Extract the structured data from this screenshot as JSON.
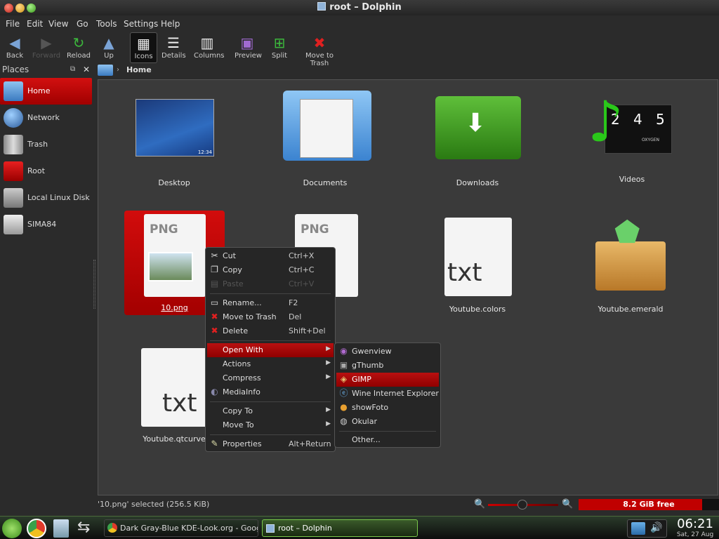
{
  "window": {
    "title": "root – Dolphin"
  },
  "menu": [
    "File",
    "Edit",
    "View",
    "Go",
    "Tools",
    "Settings",
    "Help"
  ],
  "toolbar": [
    "Back",
    "Forward",
    "Reload",
    "Up",
    "Icons",
    "Details",
    "Columns",
    "Preview",
    "Split",
    "Move to Trash"
  ],
  "places": {
    "title": "Places",
    "items": [
      "Home",
      "Network",
      "Trash",
      "Root",
      "Local Linux Disk",
      "SIMA84"
    ]
  },
  "breadcrumb": {
    "current": "Home"
  },
  "files": [
    "Desktop",
    "Documents",
    "Downloads",
    "Videos",
    "10.png",
    "",
    "Youtube.colors",
    "Youtube.emerald",
    "Youtube.qtcurve"
  ],
  "thumb_text": {
    "png": "PNG",
    "txt": "txt",
    "clock_small": "12:34",
    "video": [
      "2",
      "4",
      "5"
    ],
    "video_sub": "OXYGEN"
  },
  "context": [
    {
      "label": "Cut",
      "shortcut": "Ctrl+X",
      "icon": "scissors-icon"
    },
    {
      "label": "Copy",
      "shortcut": "Ctrl+C",
      "icon": "copy-icon"
    },
    {
      "label": "Paste",
      "shortcut": "Ctrl+V",
      "icon": "paste-icon",
      "disabled": true
    },
    {
      "label": "Rename...",
      "shortcut": "F2",
      "icon": "rename-icon"
    },
    {
      "label": "Move to Trash",
      "shortcut": "Del",
      "icon": "trash-x-icon"
    },
    {
      "label": "Delete",
      "shortcut": "Shift+Del",
      "icon": "delete-x-icon"
    },
    {
      "label": "Open With",
      "shortcut": "",
      "icon": ""
    },
    {
      "label": "Actions",
      "shortcut": "",
      "icon": ""
    },
    {
      "label": "Compress",
      "shortcut": "",
      "icon": ""
    },
    {
      "label": "MediaInfo",
      "shortcut": "",
      "icon": "mediainfo-icon"
    },
    {
      "label": "Copy To",
      "shortcut": "",
      "icon": ""
    },
    {
      "label": "Move To",
      "shortcut": "",
      "icon": ""
    },
    {
      "label": "Properties",
      "shortcut": "Alt+Return",
      "icon": "properties-icon"
    }
  ],
  "openwith": [
    "Gwenview",
    "gThumb",
    "GIMP",
    "Wine Internet Explorer",
    "showFoto",
    "Okular",
    "Other..."
  ],
  "status": {
    "text": "'10.png' selected (256.5 KiB)",
    "free": "8.2 GiB free"
  },
  "taskbar": {
    "tasks": [
      "Dark Gray-Blue KDE-Look.org - Google C",
      "root – Dolphin"
    ],
    "time": "06:21",
    "date": "Sat, 27 Aug"
  },
  "colors": {
    "accent": "#c00000",
    "bg": "#2b2b2b",
    "view": "#3a3a3a"
  }
}
